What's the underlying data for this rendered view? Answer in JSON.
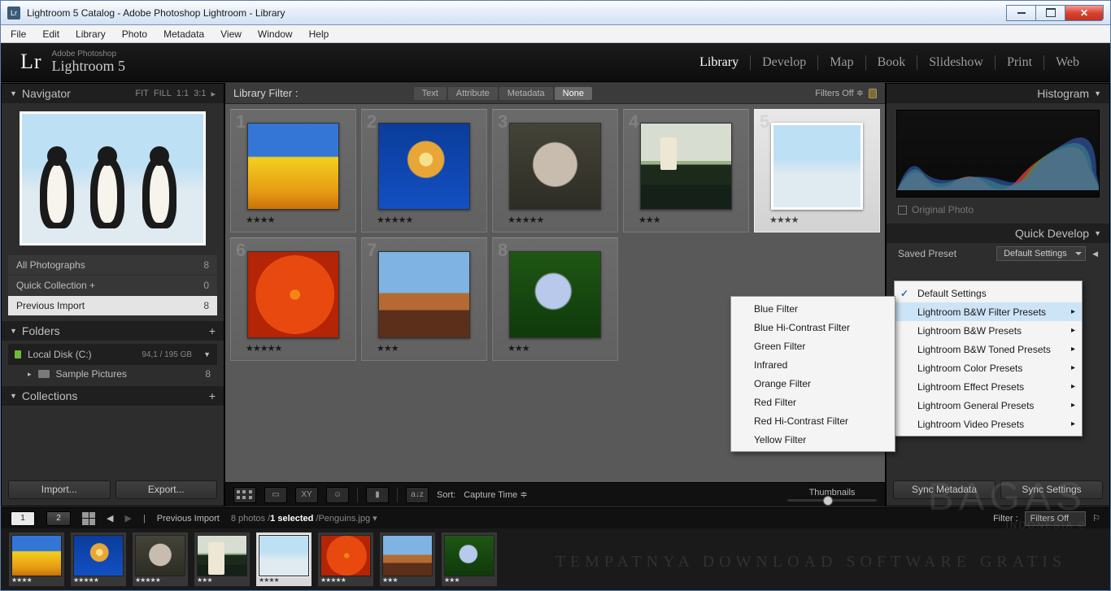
{
  "window": {
    "title": "Lightroom 5 Catalog - Adobe Photoshop Lightroom - Library"
  },
  "menuBar": [
    "File",
    "Edit",
    "Library",
    "Photo",
    "Metadata",
    "View",
    "Window",
    "Help"
  ],
  "brand": {
    "sup": "Adobe Photoshop",
    "main": "Lightroom 5",
    "mark": "Lr"
  },
  "modules": [
    "Library",
    "Develop",
    "Map",
    "Book",
    "Slideshow",
    "Print",
    "Web"
  ],
  "activeModule": "Library",
  "leftPanel": {
    "navigator": {
      "title": "Navigator",
      "opts": [
        "FIT",
        "FILL",
        "1:1",
        "3:1"
      ]
    },
    "catalog": [
      {
        "label": "All Photographs",
        "count": 8
      },
      {
        "label": "Quick Collection  +",
        "count": 0
      },
      {
        "label": "Previous Import",
        "count": 8,
        "selected": true
      }
    ],
    "folders": {
      "title": "Folders",
      "disk": {
        "name": "Local Disk (C:)",
        "gb": "94,1 / 195 GB"
      },
      "items": [
        {
          "name": "Sample Pictures",
          "count": 8
        }
      ]
    },
    "collections": {
      "title": "Collections"
    },
    "importBtn": "Import...",
    "exportBtn": "Export..."
  },
  "filterBar": {
    "label": "Library Filter :",
    "segs": [
      "Text",
      "Attribute",
      "Metadata",
      "None"
    ],
    "activeSeg": "None",
    "filtersOff": "Filters Off"
  },
  "gridItems": [
    {
      "idx": 1,
      "rating": 4,
      "cls": "th-tulips"
    },
    {
      "idx": 2,
      "rating": 5,
      "cls": "th-jelly"
    },
    {
      "idx": 3,
      "rating": 5,
      "cls": "th-koala"
    },
    {
      "idx": 4,
      "rating": 3,
      "cls": "th-light"
    },
    {
      "idx": 5,
      "rating": 4,
      "cls": "th-peng",
      "selected": true
    },
    {
      "idx": 6,
      "rating": 5,
      "cls": "th-flower"
    },
    {
      "idx": 7,
      "rating": 3,
      "cls": "th-desert"
    },
    {
      "idx": 8,
      "rating": 3,
      "cls": "th-hydra"
    }
  ],
  "toolbar": {
    "sortLabel": "Sort:",
    "sortValue": "Capture Time",
    "thumbLabel": "Thumbnails"
  },
  "rightPanel": {
    "histogram": "Histogram",
    "originalPhoto": "Original Photo",
    "quickDevelop": "Quick Develop",
    "savedPreset": {
      "label": "Saved Preset",
      "value": "Default Settings"
    },
    "syncMetadata": "Sync Metadata",
    "syncSettings": "Sync Settings"
  },
  "dropdown1": [
    {
      "label": "Default Settings",
      "checked": true
    },
    {
      "label": "Lightroom B&W Filter Presets",
      "hasSub": true,
      "hov": true
    },
    {
      "label": "Lightroom B&W Presets",
      "hasSub": true
    },
    {
      "label": "Lightroom B&W Toned Presets",
      "hasSub": true
    },
    {
      "label": "Lightroom Color Presets",
      "hasSub": true
    },
    {
      "label": "Lightroom Effect Presets",
      "hasSub": true
    },
    {
      "label": "Lightroom General Presets",
      "hasSub": true
    },
    {
      "label": "Lightroom Video Presets",
      "hasSub": true
    }
  ],
  "dropdown2": [
    "Blue Filter",
    "Blue Hi-Contrast Filter",
    "Green Filter",
    "Infrared",
    "Orange Filter",
    "Red Filter",
    "Red Hi-Contrast Filter",
    "Yellow Filter"
  ],
  "statusBar": {
    "btn1": "1",
    "btn2": "2",
    "breadcrumb": "Previous Import",
    "summary_photos": "8 photos /",
    "summary_sel": "1 selected",
    "summary_file": " /Penguins.jpg",
    "filterLbl": "Filter :",
    "filterVal": "Filters Off"
  },
  "filmstrip": [
    {
      "cls": "th-tulips",
      "r": 4
    },
    {
      "cls": "th-jelly",
      "r": 5
    },
    {
      "cls": "th-koala",
      "r": 5
    },
    {
      "cls": "th-light",
      "r": 3
    },
    {
      "cls": "th-peng",
      "r": 4,
      "sel": true
    },
    {
      "cls": "th-flower",
      "r": 5
    },
    {
      "cls": "th-desert",
      "r": 3
    },
    {
      "cls": "th-hydra",
      "r": 3
    }
  ],
  "watermark": {
    "brand": "BAGAS",
    "sub": "INDONESIA   ©",
    "tagline": "TEMPATNYA DOWNLOAD SOFTWARE GRATIS"
  }
}
